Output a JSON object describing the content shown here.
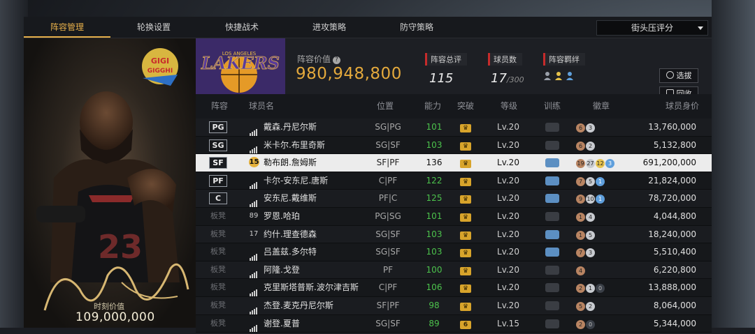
{
  "tabs": [
    {
      "label": "阵容管理",
      "active": true
    },
    {
      "label": "轮换设置",
      "active": false
    },
    {
      "label": "快捷战术",
      "active": false
    },
    {
      "label": "进攻策略",
      "active": false
    },
    {
      "label": "防守策略",
      "active": false
    }
  ],
  "dropdown": {
    "selected": "街头压评分"
  },
  "card": {
    "value_label": "时刻价值",
    "value": "109,000,000",
    "logo_text": "GIGI GIGGHI",
    "jersey_number": "23"
  },
  "header": {
    "team_logo_text": "LAKERS",
    "team_logo_sub": "LOS ANGELES",
    "value_label": "阵容价值",
    "value": "980,948,800",
    "overall_label": "阵容总评",
    "overall": "115",
    "count_label": "球员数",
    "count": "17",
    "count_max": "/300",
    "bond_label": "阵容羁绊",
    "select_button": "选拔",
    "recycle_button": "回收"
  },
  "columns": [
    "阵容",
    "球员名",
    "位置",
    "能力",
    "突破",
    "等级",
    "训练",
    "徽章",
    "球员身价"
  ],
  "rows": [
    {
      "slot": "PG",
      "bench": false,
      "num": "",
      "name": "戴森.丹尼尔斯",
      "pos": "SG|PG",
      "ability": "101",
      "level": "Lv.20",
      "trained": false,
      "badges": [
        [
          "b-br",
          "6"
        ],
        [
          "b-sv",
          "3"
        ]
      ],
      "value": "13,760,000"
    },
    {
      "slot": "SG",
      "bench": false,
      "num": "",
      "name": "米卡尔.布里奇斯",
      "pos": "SG|SF",
      "ability": "103",
      "level": "Lv.20",
      "trained": false,
      "badges": [
        [
          "b-br",
          "6"
        ],
        [
          "b-sv",
          "2"
        ]
      ],
      "value": "5,132,800"
    },
    {
      "slot": "SF",
      "bench": false,
      "num": "15",
      "name": "勒布朗.詹姆斯",
      "pos": "SF|PF",
      "ability": "136",
      "level": "Lv.20",
      "trained": true,
      "badges": [
        [
          "b-br",
          "19"
        ],
        [
          "b-sv",
          "27"
        ],
        [
          "b-gd",
          "12"
        ],
        [
          "b-hf",
          "3"
        ]
      ],
      "value": "691,200,000",
      "selected": true
    },
    {
      "slot": "PF",
      "bench": false,
      "num": "",
      "name": "卡尔-安东尼.唐斯",
      "pos": "C|PF",
      "ability": "122",
      "level": "Lv.20",
      "trained": true,
      "badges": [
        [
          "b-br",
          "7"
        ],
        [
          "b-sv",
          "5"
        ],
        [
          "b-hf",
          "1"
        ]
      ],
      "value": "21,824,000"
    },
    {
      "slot": "C",
      "bench": false,
      "num": "",
      "name": "安东尼.戴维斯",
      "pos": "PF|C",
      "ability": "125",
      "level": "Lv.20",
      "trained": true,
      "badges": [
        [
          "b-br",
          "9"
        ],
        [
          "b-sv",
          "10"
        ],
        [
          "b-hf",
          "1"
        ]
      ],
      "value": "78,720,000"
    },
    {
      "slot": "板凳",
      "bench": true,
      "num": "89",
      "name": "罗恩.哈珀",
      "pos": "PG|SG",
      "ability": "101",
      "level": "Lv.20",
      "trained": false,
      "badges": [
        [
          "b-br",
          "1"
        ],
        [
          "b-sv",
          "4"
        ]
      ],
      "value": "4,044,800"
    },
    {
      "slot": "板凳",
      "bench": true,
      "num": "17",
      "name": "约什.理查德森",
      "pos": "SG|SF",
      "ability": "103",
      "level": "Lv.20",
      "trained": true,
      "badges": [
        [
          "b-br",
          "1"
        ],
        [
          "b-sv",
          "5"
        ]
      ],
      "value": "18,240,000"
    },
    {
      "slot": "板凳",
      "bench": true,
      "num": "",
      "name": "吕盖兹.多尔特",
      "pos": "SG|SF",
      "ability": "103",
      "level": "Lv.20",
      "trained": true,
      "badges": [
        [
          "b-br",
          "7"
        ],
        [
          "b-sv",
          "3"
        ]
      ],
      "value": "5,510,400"
    },
    {
      "slot": "板凳",
      "bench": true,
      "num": "",
      "name": "阿隆.戈登",
      "pos": "PF",
      "ability": "100",
      "level": "Lv.20",
      "trained": false,
      "badges": [
        [
          "b-br",
          "4"
        ]
      ],
      "value": "6,220,800"
    },
    {
      "slot": "板凳",
      "bench": true,
      "num": "",
      "name": "克里斯塔普斯.波尔津吉斯",
      "pos": "C|PF",
      "ability": "106",
      "level": "Lv.20",
      "trained": false,
      "badges": [
        [
          "b-br",
          "2"
        ],
        [
          "b-sv",
          "1"
        ],
        [
          "b-ds",
          "0"
        ]
      ],
      "value": "13,888,000"
    },
    {
      "slot": "板凳",
      "bench": true,
      "num": "",
      "name": "杰登.麦克丹尼尔斯",
      "pos": "SF|PF",
      "ability": "98",
      "level": "Lv.20",
      "trained": false,
      "badges": [
        [
          "b-br",
          "5"
        ],
        [
          "b-sv",
          "2"
        ]
      ],
      "value": "8,064,000"
    },
    {
      "slot": "板凳",
      "bench": true,
      "num": "",
      "name": "谢登.夏普",
      "pos": "SG|SF",
      "ability": "89",
      "level": "Lv.15",
      "trained": false,
      "badges": [
        [
          "b-br",
          "2"
        ],
        [
          "b-ds",
          "0"
        ]
      ],
      "value": "5,344,000",
      "break_num": "6"
    }
  ],
  "colors": {
    "accent": "#e7b04a",
    "ability": "#4cc24c",
    "team_value": "#e4a93c",
    "stat_marker": "#c62b2b"
  }
}
